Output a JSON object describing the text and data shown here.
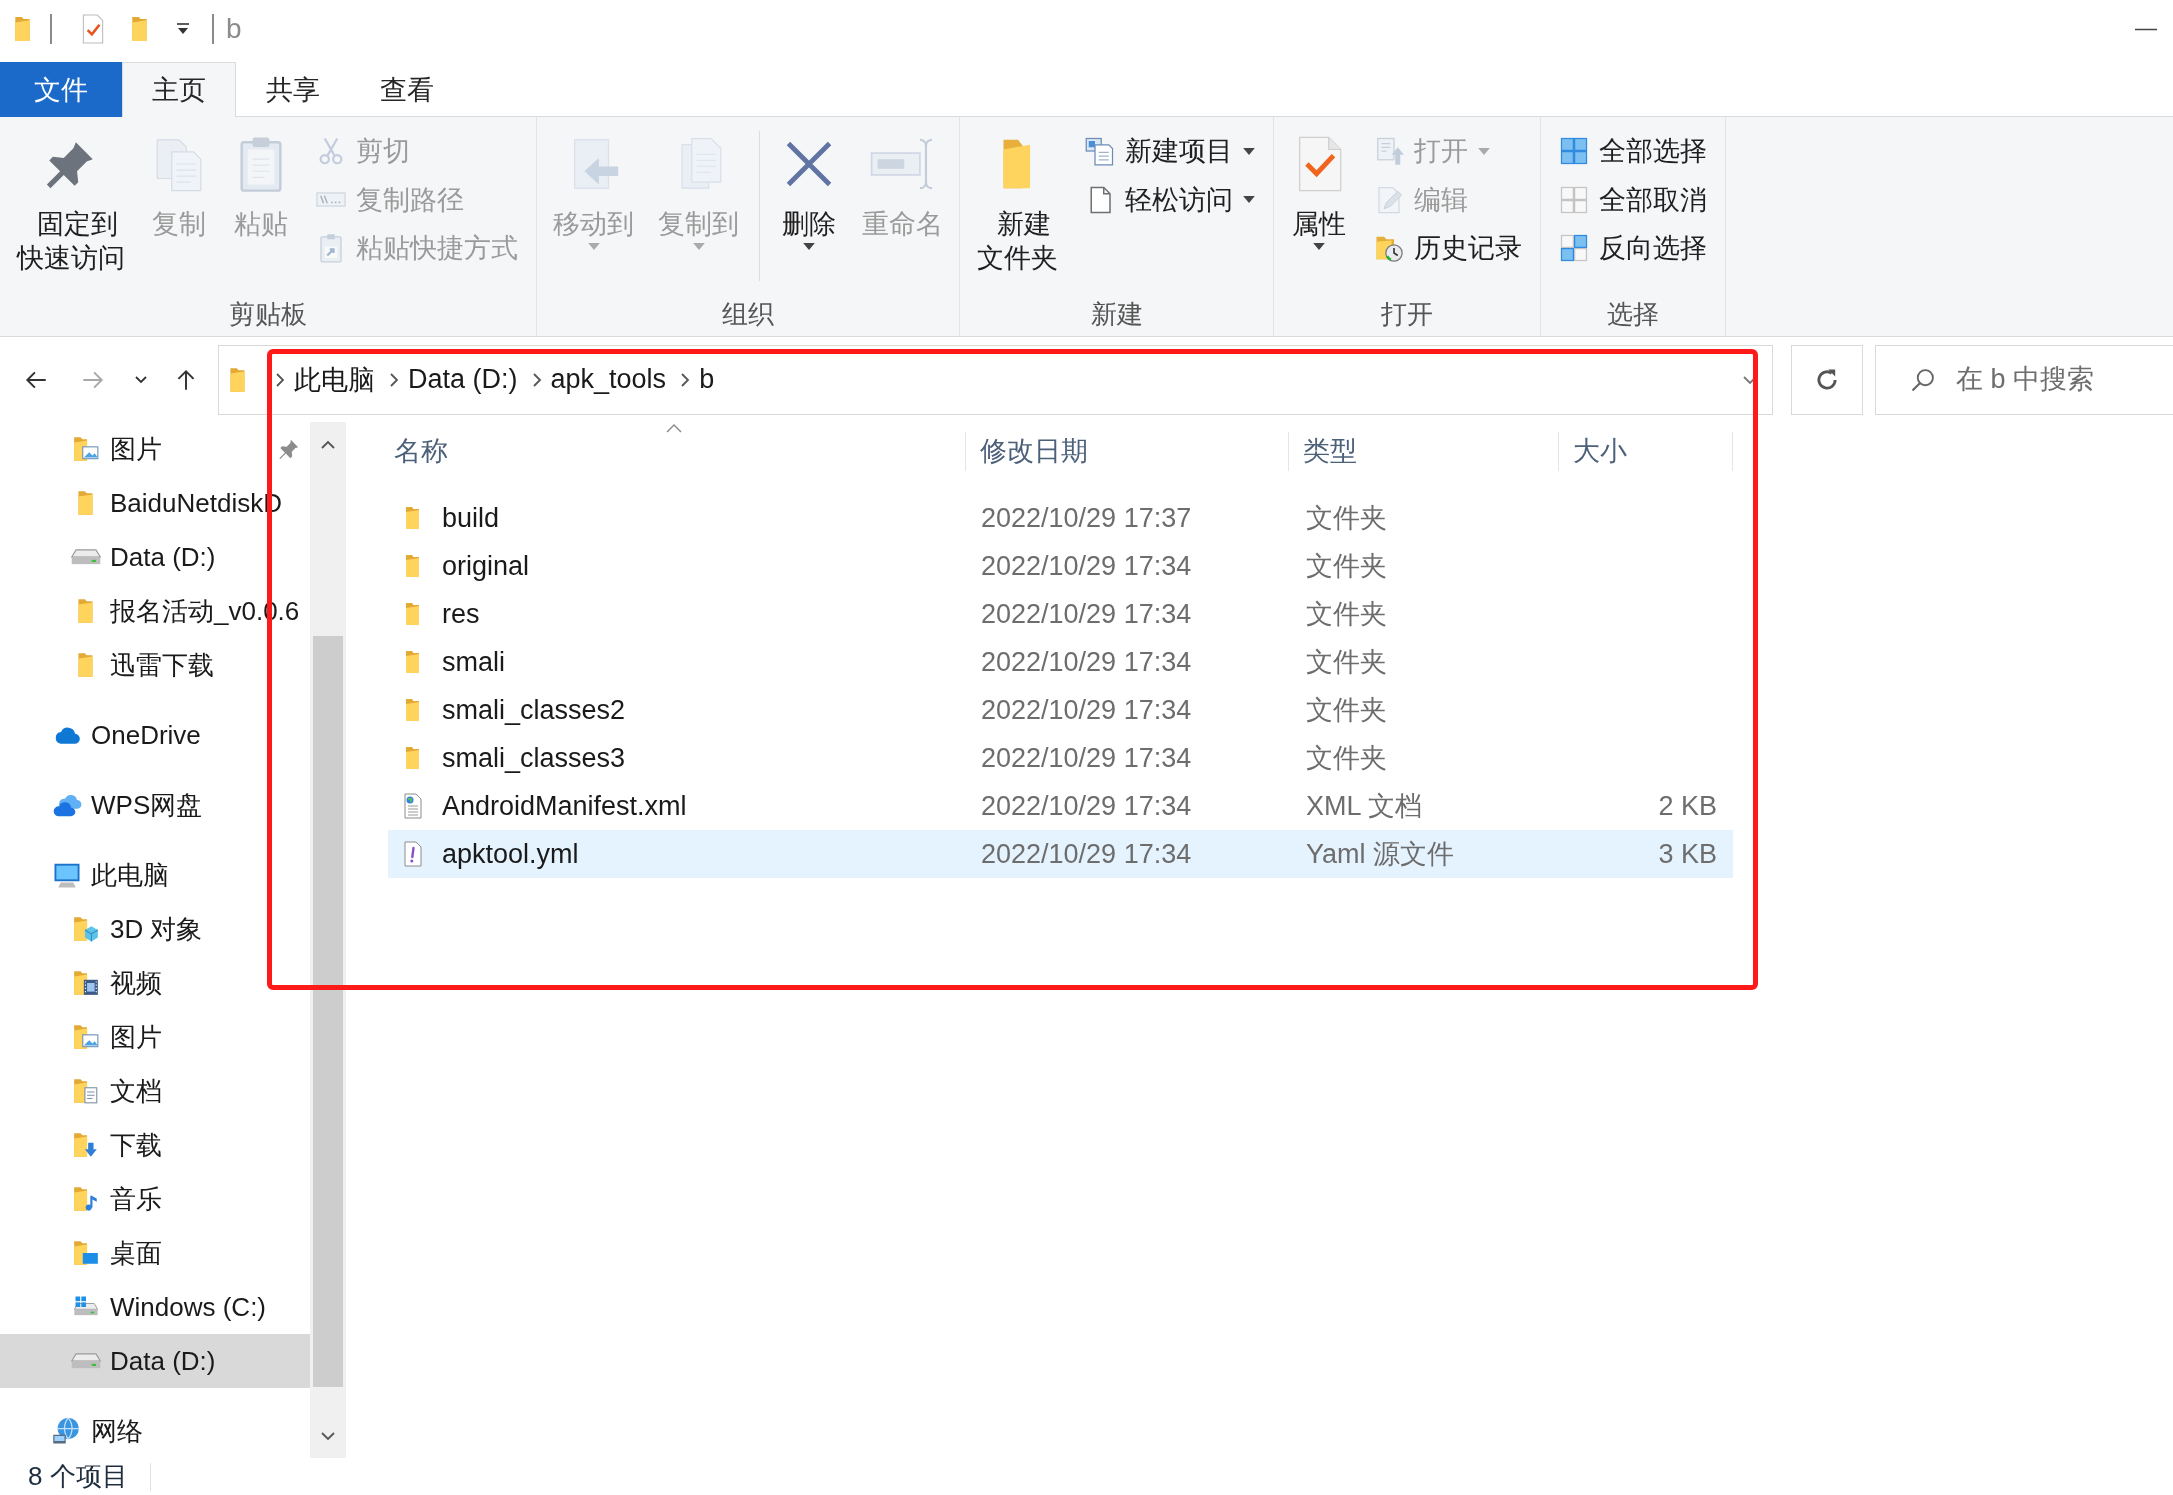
{
  "title_bar": {
    "title": "b"
  },
  "ribbon_tabs": [
    {
      "label": "文件",
      "kind": "menu",
      "selected": false
    },
    {
      "label": "主页",
      "kind": "tab",
      "selected": true
    },
    {
      "label": "共享",
      "kind": "tab",
      "selected": false
    },
    {
      "label": "查看",
      "kind": "tab",
      "selected": false
    }
  ],
  "ribbon_groups": [
    {
      "label": "剪贴板",
      "buttons": [
        {
          "kind": "large",
          "label": "固定到快速访问",
          "disabled": false,
          "dropdown": false
        },
        {
          "kind": "large",
          "label": "复制",
          "disabled": true,
          "dropdown": false
        },
        {
          "kind": "large",
          "label": "粘贴",
          "disabled": true,
          "dropdown": false
        },
        {
          "kind": "stack",
          "buttons": [
            {
              "label": "剪切",
              "disabled": true,
              "dropdown": false
            },
            {
              "label": "复制路径",
              "disabled": true,
              "dropdown": false
            },
            {
              "label": "粘贴快捷方式",
              "disabled": true,
              "dropdown": false
            }
          ]
        }
      ]
    },
    {
      "label": "组织",
      "buttons": [
        {
          "kind": "large",
          "label": "移动到",
          "disabled": true,
          "dropdown": true
        },
        {
          "kind": "large",
          "label": "复制到",
          "disabled": true,
          "dropdown": true
        },
        {
          "kind": "divider"
        },
        {
          "kind": "large",
          "label": "删除",
          "disabled": false,
          "dropdown": true
        },
        {
          "kind": "large",
          "label": "重命名",
          "disabled": true,
          "dropdown": false
        }
      ]
    },
    {
      "label": "新建",
      "buttons": [
        {
          "kind": "large",
          "label": "新建文件夹",
          "disabled": false,
          "dropdown": false
        },
        {
          "kind": "stack",
          "buttons": [
            {
              "label": "新建项目",
              "disabled": false,
              "dropdown": true
            },
            {
              "label": "轻松访问",
              "disabled": false,
              "dropdown": true
            }
          ]
        }
      ]
    },
    {
      "label": "打开",
      "buttons": [
        {
          "kind": "large",
          "label": "属性",
          "disabled": false,
          "dropdown": true
        },
        {
          "kind": "stack",
          "buttons": [
            {
              "label": "打开",
              "disabled": true,
              "dropdown": true
            },
            {
              "label": "编辑",
              "disabled": true,
              "dropdown": false
            },
            {
              "label": "历史记录",
              "disabled": false,
              "dropdown": false
            }
          ]
        }
      ]
    },
    {
      "label": "选择",
      "buttons": [
        {
          "kind": "stack",
          "buttons": [
            {
              "label": "全部选择",
              "disabled": false,
              "dropdown": false
            },
            {
              "label": "全部取消",
              "disabled": false,
              "dropdown": false
            },
            {
              "label": "反向选择",
              "disabled": false,
              "dropdown": false
            }
          ]
        }
      ]
    }
  ],
  "address_bar": {
    "nav_buttons": [
      {
        "kind": "back",
        "disabled": false
      },
      {
        "kind": "forward",
        "disabled": true
      },
      {
        "kind": "recent",
        "disabled": false
      },
      {
        "kind": "up",
        "disabled": false
      }
    ],
    "path": [
      "此电脑",
      "Data (D:)",
      "apk_tools",
      "b"
    ]
  },
  "search": {
    "placeholder": "在 b 中搜索"
  },
  "nav_pane": {
    "quick_access_items": [
      {
        "label": "图片",
        "kind": "pictures",
        "pinned": true,
        "selected": false
      },
      {
        "label": "BaiduNetdiskD",
        "kind": "folder",
        "pinned": false,
        "selected": false
      },
      {
        "label": "Data (D:)",
        "kind": "drive",
        "pinned": false,
        "selected": false
      },
      {
        "label": "报名活动_v0.0.6",
        "kind": "folder",
        "pinned": false,
        "selected": false
      },
      {
        "label": "迅雷下载",
        "kind": "folder",
        "pinned": false,
        "selected": false
      }
    ],
    "items": [
      {
        "label": "OneDrive",
        "kind": "cloud",
        "selected": false
      },
      {
        "label": "WPS网盘",
        "kind": "clouds",
        "selected": false
      },
      {
        "label": "此电脑",
        "kind": "computer",
        "selected": false,
        "children": [
          {
            "label": "3D 对象",
            "kind": "objects",
            "selected": false
          },
          {
            "label": "视频",
            "kind": "videos",
            "selected": false
          },
          {
            "label": "图片",
            "kind": "pictures",
            "selected": false
          },
          {
            "label": "文档",
            "kind": "documents",
            "selected": false
          },
          {
            "label": "下载",
            "kind": "downloads",
            "selected": false
          },
          {
            "label": "音乐",
            "kind": "music",
            "selected": false
          },
          {
            "label": "桌面",
            "kind": "desktop",
            "selected": false
          },
          {
            "label": "Windows (C:)",
            "kind": "system",
            "selected": false
          },
          {
            "label": "Data (D:)",
            "kind": "drive",
            "selected": true
          }
        ]
      },
      {
        "label": "网络",
        "kind": "network",
        "selected": false
      }
    ]
  },
  "file_list": {
    "columns": [
      {
        "label": "名称",
        "sorted": true
      },
      {
        "label": "修改日期",
        "sorted": false
      },
      {
        "label": "类型",
        "sorted": false
      },
      {
        "label": "大小",
        "sorted": false
      }
    ],
    "rows": [
      {
        "name": "build",
        "modified": "2022/10/29 17:37",
        "type": "文件夹",
        "kind": "folder",
        "selected": false
      },
      {
        "name": "original",
        "modified": "2022/10/29 17:34",
        "type": "文件夹",
        "kind": "folder",
        "selected": false
      },
      {
        "name": "res",
        "modified": "2022/10/29 17:34",
        "type": "文件夹",
        "kind": "folder",
        "selected": false
      },
      {
        "name": "smali",
        "modified": "2022/10/29 17:34",
        "type": "文件夹",
        "kind": "folder",
        "selected": false
      },
      {
        "name": "smali_classes2",
        "modified": "2022/10/29 17:34",
        "type": "文件夹",
        "kind": "folder",
        "selected": false
      },
      {
        "name": "smali_classes3",
        "modified": "2022/10/29 17:34",
        "type": "文件夹",
        "kind": "folder",
        "selected": false
      },
      {
        "name": "AndroidManifest.xml",
        "modified": "2022/10/29 17:34",
        "type": "XML 文档",
        "size": "2 KB",
        "kind": "xml",
        "selected": false
      },
      {
        "name": "apktool.yml",
        "modified": "2022/10/29 17:34",
        "type": "Yaml 源文件",
        "size": "3 KB",
        "kind": "yaml",
        "selected": true
      }
    ]
  },
  "status_bar": {
    "item_count": "8 个项目"
  }
}
